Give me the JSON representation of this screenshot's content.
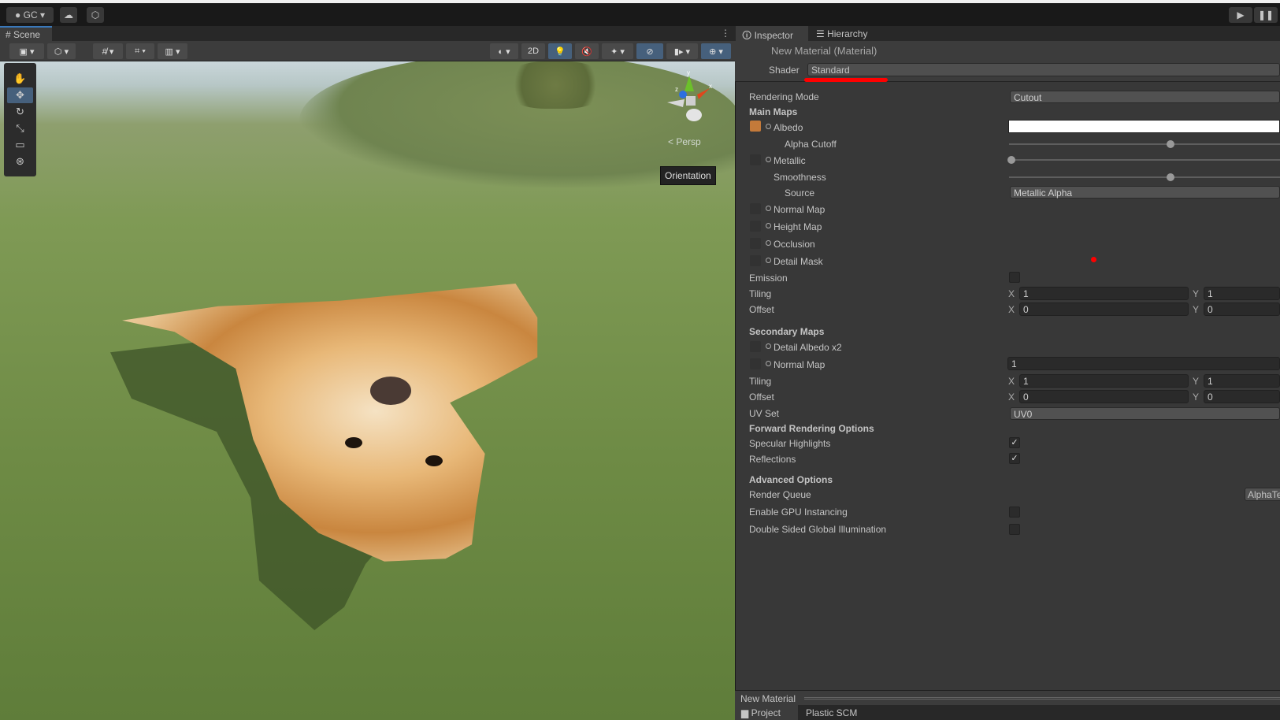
{
  "topbar": {
    "account": "GC",
    "cloud_icon": "cloud-icon",
    "collab_icon": "plastic-icon",
    "play_icon": "play-icon",
    "pause_icon": "pause-icon"
  },
  "scene": {
    "tab": "Scene",
    "view_2d": "2D",
    "persp": "< Persp",
    "tooltip": "Orientation",
    "gizmo_axes": {
      "x": "x",
      "y": "y",
      "z": "z"
    }
  },
  "inspector": {
    "tabs": [
      "Inspector",
      "Hierarchy"
    ],
    "title": "New Material (Material)",
    "shader_label": "Shader",
    "shader_value": "Standard",
    "rendering_mode": {
      "label": "Rendering Mode",
      "value": "Cutout"
    },
    "main_maps": "Main Maps",
    "albedo": "Albedo",
    "albedo_color": "#ffffff",
    "alpha_cutoff": {
      "label": "Alpha Cutoff",
      "value": 0.5
    },
    "metallic": {
      "label": "Metallic",
      "value": 0
    },
    "smoothness": {
      "label": "Smoothness",
      "value": 0.5
    },
    "source": {
      "label": "Source",
      "value": "Metallic Alpha"
    },
    "normal_map": "Normal Map",
    "height_map": "Height Map",
    "occlusion": "Occlusion",
    "detail_mask": "Detail Mask",
    "emission": {
      "label": "Emission",
      "checked": false
    },
    "tiling": {
      "label": "Tiling",
      "x": "1",
      "y": "1"
    },
    "offset": {
      "label": "Offset",
      "x": "0",
      "y": "0"
    },
    "secondary_maps": "Secondary Maps",
    "detail_albedo": "Detail Albedo x2",
    "sec_normal_map": {
      "label": "Normal Map",
      "value": "1"
    },
    "sec_tiling": {
      "label": "Tiling",
      "x": "1",
      "y": "1"
    },
    "sec_offset": {
      "label": "Offset",
      "x": "0",
      "y": "0"
    },
    "uv_set": {
      "label": "UV Set",
      "value": "UV0"
    },
    "forward": "Forward Rendering Options",
    "specular": {
      "label": "Specular Highlights",
      "checked": true
    },
    "reflections": {
      "label": "Reflections",
      "checked": true
    },
    "advanced": "Advanced Options",
    "render_queue": {
      "label": "Render Queue",
      "value": "AlphaTest"
    },
    "gpu": {
      "label": "Enable GPU Instancing",
      "checked": false
    },
    "dsgi": {
      "label": "Double Sided Global Illumination",
      "checked": false
    },
    "xl": "X",
    "yl": "Y",
    "check": "✓",
    "preview_title": "New Material"
  },
  "bottom_tabs": [
    "Project",
    "Plastic SCM"
  ],
  "colors": {
    "accent": "#3a79bb",
    "annotation": "#ff0000"
  }
}
